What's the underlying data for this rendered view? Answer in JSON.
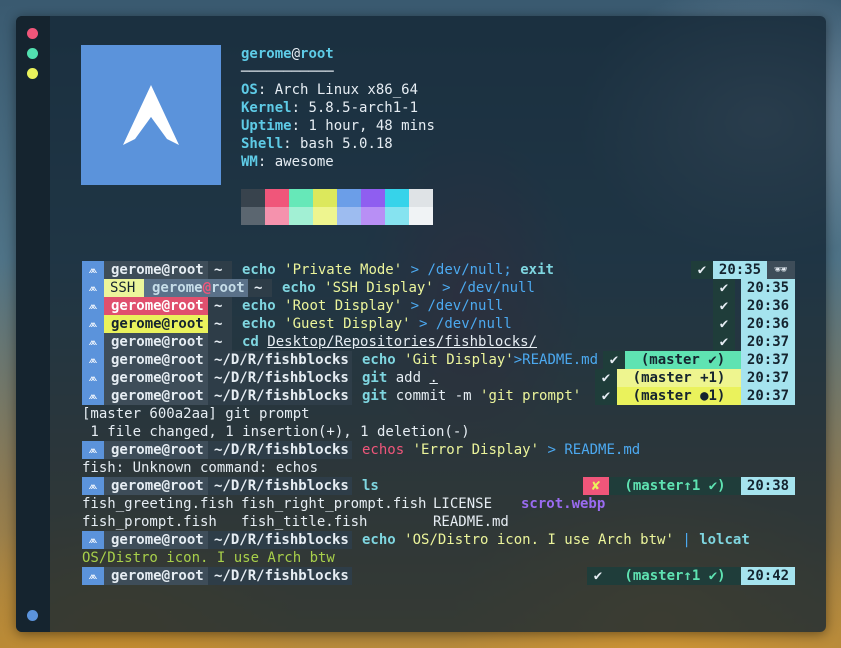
{
  "sysinfo": {
    "user": "gerome",
    "at": "@",
    "host": "root",
    "rule": "───────────",
    "rows": [
      {
        "key": "OS",
        "value": "Arch Linux x86_64"
      },
      {
        "key": "Kernel",
        "value": "5.8.5-arch1-1"
      },
      {
        "key": "Uptime",
        "value": "1 hour, 48 mins"
      },
      {
        "key": "Shell",
        "value": "bash 5.0.18"
      },
      {
        "key": "WM",
        "value": "awesome"
      }
    ]
  },
  "palette": {
    "row1": [
      "#38434d",
      "#f0567a",
      "#66e8b8",
      "#dce85c",
      "#6b9ee8",
      "#8f5ef0",
      "#36d3ea",
      "#dfe3e6"
    ],
    "row2": [
      "#5b6670",
      "#f592ad",
      "#a2f0d4",
      "#eef58f",
      "#9dbcf0",
      "#b88ff5",
      "#86e3f0",
      "#f0f3f5"
    ]
  },
  "prompt": {
    "user": "gerome@root",
    "arch_icon": "arch-logo-icon",
    "tilde": "~",
    "path": "~/D/R/fishblocks",
    "check": "✔",
    "cross": "✘"
  },
  "lines": {
    "l1": {
      "echo": "echo",
      "str": "'Private Mode'",
      "redir": ">",
      "dev": "/dev/null",
      "sep": ";",
      "exit": "exit",
      "time": "20:35",
      "private_icon": "incognito-icon"
    },
    "l2": {
      "ssh": "SSH",
      "user": "gerome",
      "at": "@",
      "host": "root",
      "echo": "echo",
      "str": "'SSH Display'",
      "redir": ">",
      "dev": "/dev/null",
      "time": "20:35"
    },
    "l3": {
      "echo": "echo",
      "str": "'Root Display'",
      "redir": ">",
      "dev": "/dev/null",
      "time": "20:36"
    },
    "l4": {
      "echo": "echo",
      "str": "'Guest Display'",
      "redir": ">",
      "dev": "/dev/null",
      "time": "20:36"
    },
    "l5": {
      "cmd": "cd",
      "arg": "Desktop/Repositories/fishblocks/",
      "time": "20:37"
    },
    "l6": {
      "echo": "echo",
      "str": "'Git Display'",
      "redir": ">",
      "file": "README.md",
      "git": "(master ✔)",
      "time": "20:37"
    },
    "l7": {
      "git": "git",
      "sub": "add",
      "arg": ".",
      "gitstatus": "(master +1)",
      "time": "20:37"
    },
    "l8": {
      "git": "git",
      "sub": "commit -m",
      "str": "'git prompt'",
      "gitstatus": "(master ●1)",
      "time": "20:37"
    },
    "out1": "[master 600a2aa] git prompt",
    "out2": " 1 file changed, 1 insertion(+), 1 deletion(-)",
    "l9": {
      "echo": "echos",
      "str": "'Error Display'",
      "redir": ">",
      "file": "README.md"
    },
    "out3": "fish: Unknown command: echos",
    "l10": {
      "cmd": "ls",
      "gitstatus": "(master↑1 ✔)",
      "time": "20:38"
    },
    "ls1": [
      "fish_greeting.fish",
      "fish_right_prompt.fish",
      "LICENSE",
      "scrot.webp"
    ],
    "ls2": [
      "fish_prompt.fish",
      "fish_title.fish",
      "README.md"
    ],
    "l11": {
      "echo": "echo",
      "str": "'OS/Distro icon. I use Arch btw'",
      "pipe": "|",
      "cmd": "lolcat"
    },
    "out4": "OS/Distro icon. I use Arch btw",
    "l12": {
      "gitstatus": "(master↑1 ✔)",
      "time": "20:42"
    }
  }
}
